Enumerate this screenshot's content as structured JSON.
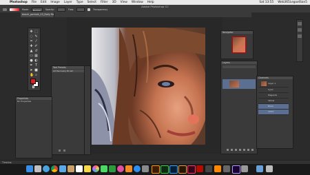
{
  "menubar": {
    "apple": "",
    "app_name": "Photoshop",
    "menus": [
      "File",
      "Edit",
      "Image",
      "Layer",
      "Type",
      "Select",
      "Filter",
      "3D",
      "View",
      "Window",
      "Help"
    ],
    "clock": "Sat 13:55",
    "user": "Web365LegoxtSan5"
  },
  "options_bar": {
    "window_title": "Adobe Photoshop CC",
    "mode_label": "Mode:",
    "mode_value": "Normal",
    "opacity_label": "Opacity:",
    "flow_label": "Flow:",
    "transparency_label": "Transparency"
  },
  "document": {
    "tab_label": "beach_portrait_03_Dolly Ret..."
  },
  "panels": {
    "tool_presets": {
      "header": "Tool Presets",
      "label": "Art Recovery Brush"
    },
    "properties": {
      "header": "Properties",
      "empty": "No Properties"
    },
    "navigator": {
      "header": "Navigator"
    },
    "layers": {
      "header": "Layers",
      "rows": [
        {
          "name": "Layer 1"
        },
        {
          "name": "Cyan"
        },
        {
          "name": "Magenta"
        },
        {
          "name": "Yellow"
        },
        {
          "name": "Black"
        },
        {
          "name": "CMYK"
        }
      ]
    },
    "channels": {
      "header": "Channels"
    }
  },
  "status": {
    "zoom": "Timeline"
  },
  "colors": {
    "foreground": "#e21b23",
    "background": "#ffffff",
    "workspace": "#2b2b2b",
    "panel": "#3a3a3a"
  },
  "dock_icons": [
    "finder-icon",
    "launchpad-icon",
    "safari-icon",
    "chrome-icon",
    "mail-icon",
    "contacts-icon",
    "calendar-icon",
    "notes-icon",
    "photos-icon",
    "messages-icon",
    "facetime-icon",
    "itunes-icon",
    "ibooks-icon",
    "appstore-icon",
    "preferences-icon",
    "illustrator-icon",
    "dreamweaver-icon",
    "photoshop-icon",
    "bridge-icon",
    "indesign-icon",
    "acrobat-icon",
    "media-icon",
    "vlc-icon",
    "camera-icon",
    "aftereffects-icon",
    "screenshot-icon",
    "folder-icon",
    "trash-icon"
  ]
}
